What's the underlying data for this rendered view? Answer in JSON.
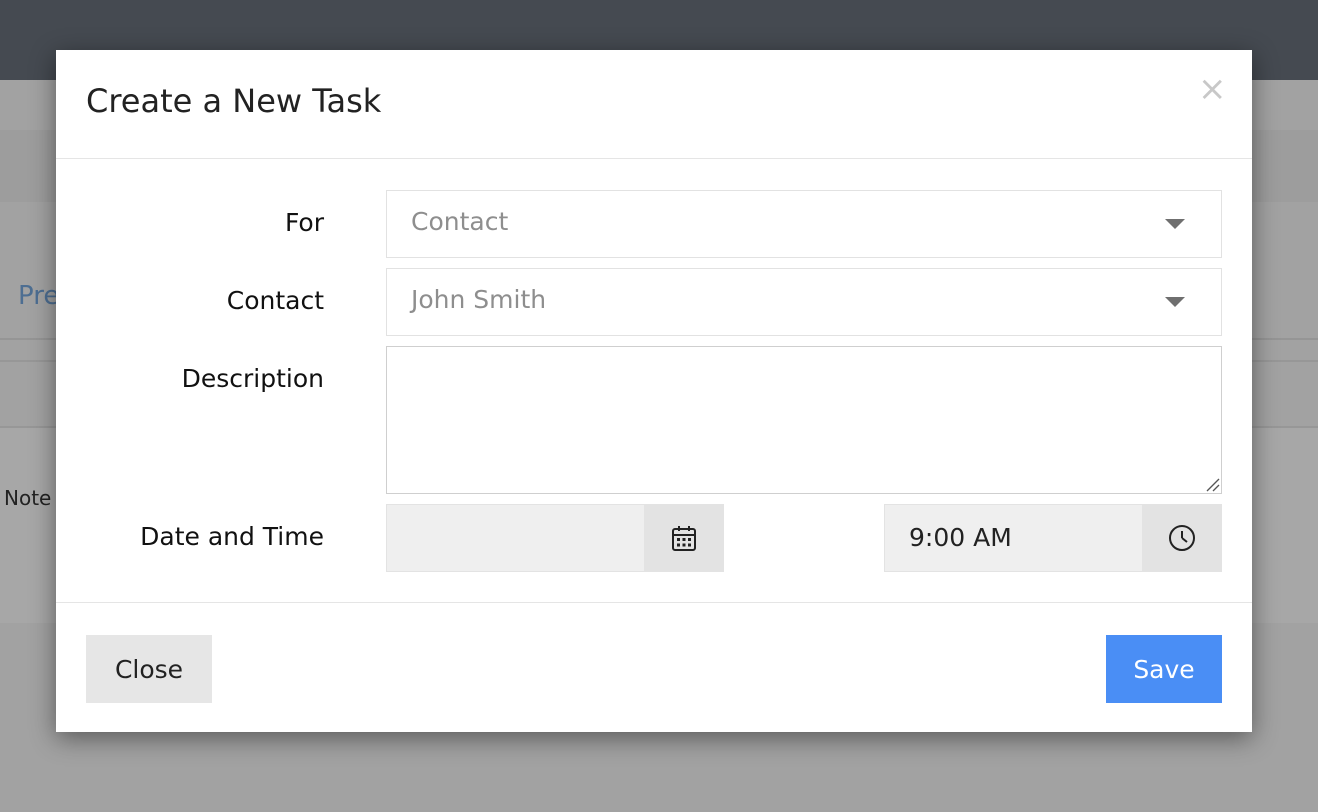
{
  "background": {
    "tab_partial": "Pre",
    "note_partial": "Note"
  },
  "modal": {
    "title": "Create a New Task",
    "close_glyph": "×",
    "fields": {
      "for": {
        "label": "For",
        "value": "Contact"
      },
      "contact": {
        "label": "Contact",
        "value": "John Smith"
      },
      "description": {
        "label": "Description",
        "value": ""
      },
      "date_time": {
        "label": "Date and Time",
        "date": "",
        "time": "9:00 AM"
      }
    },
    "footer": {
      "close_label": "Close",
      "save_label": "Save"
    }
  },
  "colors": {
    "primary": "#4a8ef5",
    "topbar": "#454a51",
    "overlay": "#a2a2a2"
  },
  "icons": [
    "close-icon",
    "chevron-down-icon",
    "calendar-icon",
    "clock-icon",
    "resize-grip-icon"
  ]
}
